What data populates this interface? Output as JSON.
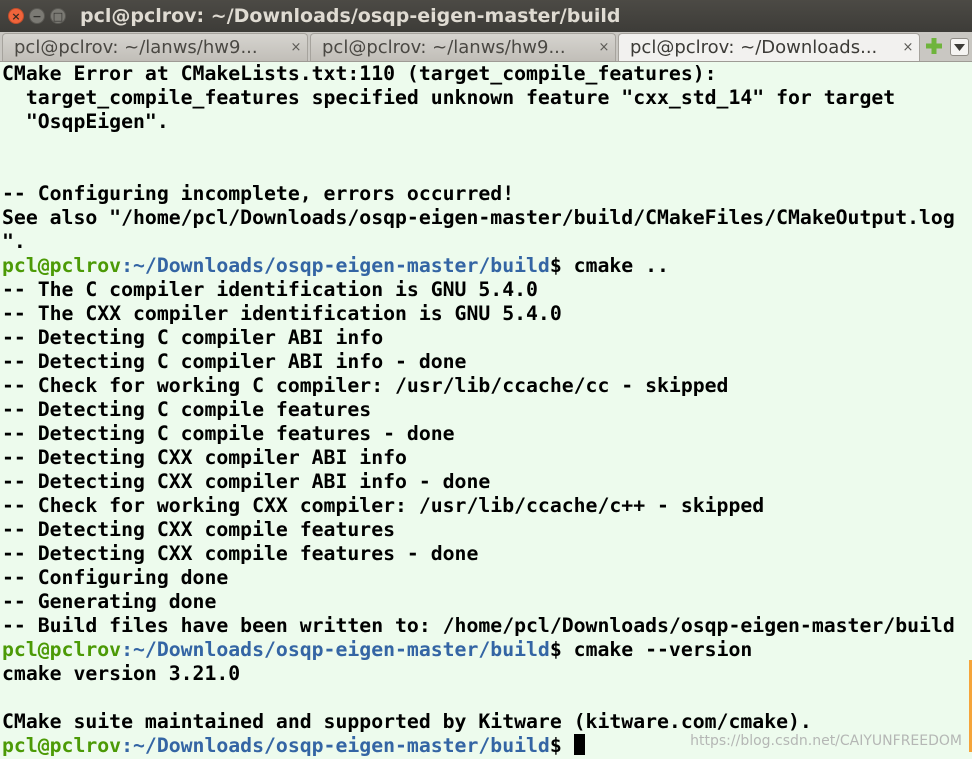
{
  "window": {
    "title": "pcl@pclrov: ~/Downloads/osqp-eigen-master/build"
  },
  "tabs": [
    {
      "label": "pcl@pclrov: ~/lanws/hw9...",
      "close": "×"
    },
    {
      "label": "pcl@pclrov: ~/lanws/hw9...",
      "close": "×"
    },
    {
      "label": "pcl@pclrov: ~/Downloads...",
      "close": "×"
    }
  ],
  "colors": {
    "prompt_user": "#4c9a06",
    "prompt_path": "#3465a4",
    "new_tab_plus": "#6fb43c",
    "close_button": "#f0643b"
  },
  "icons": {
    "close": "close-icon",
    "minimize": "minimize-icon",
    "maximize": "maximize-icon",
    "new_tab": "plus-icon",
    "tab_menu": "chevron-down-icon"
  },
  "prompt": {
    "user": "pcl@pclrov",
    "path": ":~/Downloads/osqp-eigen-master/build"
  },
  "terminal": {
    "lines": [
      {
        "t": "CMake Error at CMakeLists.txt:110 (target_compile_features):"
      },
      {
        "t": "  target_compile_features specified unknown feature \"cxx_std_14\" for target"
      },
      {
        "t": "  \"OsqpEigen\"."
      },
      {
        "t": ""
      },
      {
        "t": ""
      },
      {
        "t": "-- Configuring incomplete, errors occurred!"
      },
      {
        "t": "See also \"/home/pcl/Downloads/osqp-eigen-master/build/CMakeFiles/CMakeOutput.log"
      },
      {
        "t": "\"."
      },
      {
        "prompt": true,
        "cmd": "$ cmake .."
      },
      {
        "t": "-- The C compiler identification is GNU 5.4.0"
      },
      {
        "t": "-- The CXX compiler identification is GNU 5.4.0"
      },
      {
        "t": "-- Detecting C compiler ABI info"
      },
      {
        "t": "-- Detecting C compiler ABI info - done"
      },
      {
        "t": "-- Check for working C compiler: /usr/lib/ccache/cc - skipped"
      },
      {
        "t": "-- Detecting C compile features"
      },
      {
        "t": "-- Detecting C compile features - done"
      },
      {
        "t": "-- Detecting CXX compiler ABI info"
      },
      {
        "t": "-- Detecting CXX compiler ABI info - done"
      },
      {
        "t": "-- Check for working CXX compiler: /usr/lib/ccache/c++ - skipped"
      },
      {
        "t": "-- Detecting CXX compile features"
      },
      {
        "t": "-- Detecting CXX compile features - done"
      },
      {
        "t": "-- Configuring done"
      },
      {
        "t": "-- Generating done"
      },
      {
        "t": "-- Build files have been written to: /home/pcl/Downloads/osqp-eigen-master/build"
      },
      {
        "prompt": true,
        "cmd": "$ cmake --version"
      },
      {
        "t": "cmake version 3.21.0"
      },
      {
        "t": ""
      },
      {
        "t": "CMake suite maintained and supported by Kitware (kitware.com/cmake)."
      },
      {
        "prompt": true,
        "cmd": "$",
        "cursor": true
      }
    ]
  },
  "watermark": "https://blog.csdn.net/CAIYUNFREEDOM"
}
